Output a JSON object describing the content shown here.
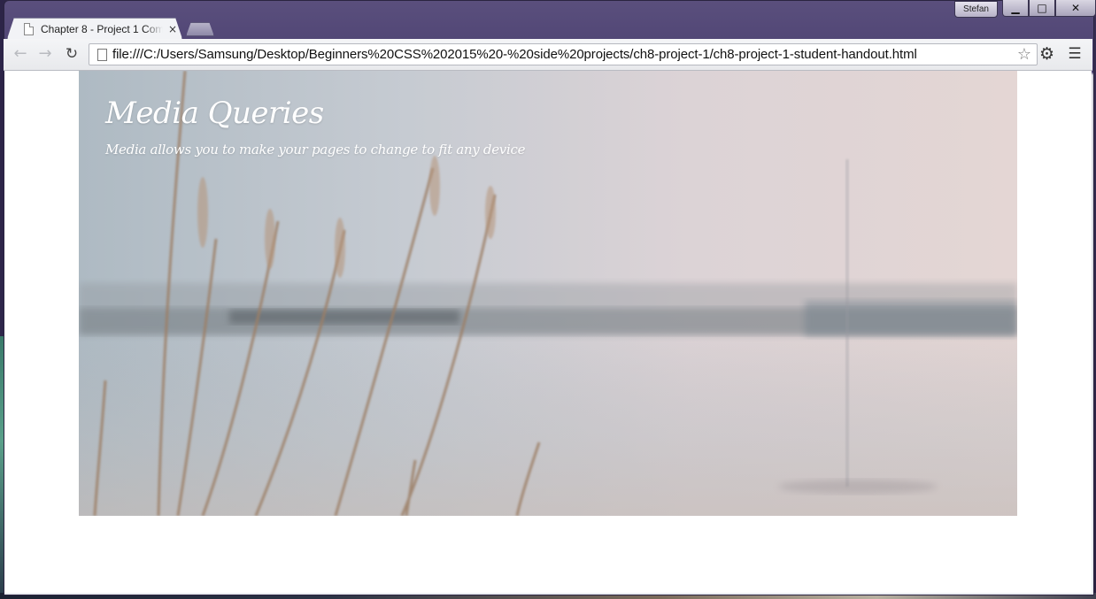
{
  "browser": {
    "profile_name": "Stefan",
    "tab": {
      "title": "Chapter 8 - Project 1 Com",
      "close_glyph": "×"
    },
    "window_controls": {
      "minimize": "▁",
      "maximize": "□",
      "close": "✕"
    },
    "url": "file:///C:/Users/Samsung/Desktop/Beginners%20CSS%202015%20-%20side%20projects/ch8-project-1/ch8-project-1-student-handout.html",
    "icons": {
      "back": "arrow-left-icon",
      "forward": "arrow-right-icon",
      "reload": "reload-icon",
      "bookmark": "star-icon",
      "settings": "gear-icon",
      "menu": "hamburger-menu-icon"
    }
  },
  "page": {
    "hero": {
      "title": "Media Queries",
      "subtitle": "Media allows you to make your pages to change to fit any device"
    }
  }
}
